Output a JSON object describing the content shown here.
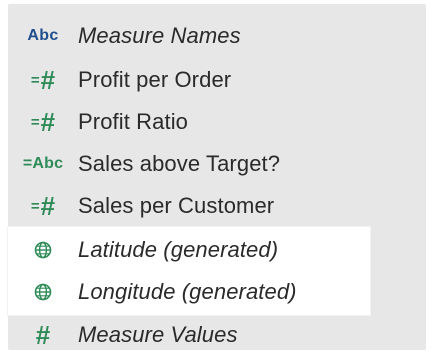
{
  "colors": {
    "panel_bg": "#e7e7e7",
    "highlight_bg": "#ffffff",
    "dimension_blue": "#1f4e8c",
    "measure_green": "#2e8b57",
    "text": "#2a2a2a"
  },
  "fields": [
    {
      "label": "Measure Names",
      "icon": "abc-dimension-icon",
      "icon_text": "Abc",
      "italic": true
    },
    {
      "label": "Profit per Order",
      "icon": "calculated-measure-icon",
      "icon_text": "=#",
      "italic": false
    },
    {
      "label": "Profit Ratio",
      "icon": "calculated-measure-icon",
      "icon_text": "=#",
      "italic": false
    },
    {
      "label": "Sales above Target?",
      "icon": "calculated-abc-icon",
      "icon_text": "=Abc",
      "italic": false
    },
    {
      "label": "Sales per Customer",
      "icon": "calculated-measure-icon",
      "icon_text": "=#",
      "italic": false
    },
    {
      "label": "Latitude (generated)",
      "icon": "globe-icon",
      "icon_text": "",
      "italic": true
    },
    {
      "label": "Longitude (generated)",
      "icon": "globe-icon",
      "icon_text": "",
      "italic": true
    },
    {
      "label": "Measure Values",
      "icon": "measure-icon",
      "icon_text": "#",
      "italic": true
    }
  ]
}
